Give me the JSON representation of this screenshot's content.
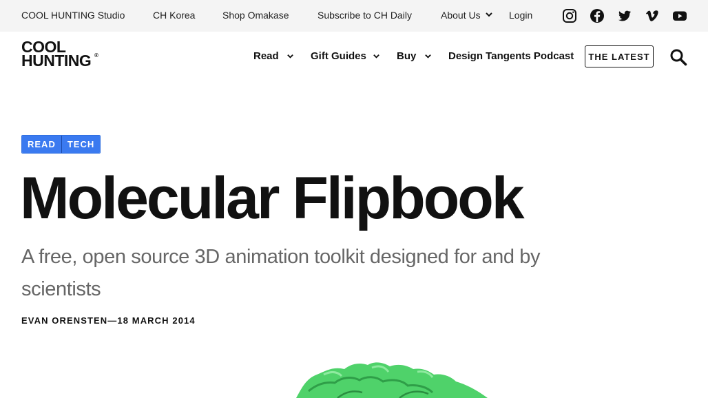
{
  "topbar": {
    "links": [
      "COOL HUNTING Studio",
      "CH Korea",
      "Shop Omakase",
      "Subscribe to CH Daily",
      "About Us",
      "Login"
    ],
    "social_icons": [
      "instagram-icon",
      "facebook-icon",
      "twitter-icon",
      "vimeo-icon",
      "youtube-icon"
    ]
  },
  "logo": {
    "line1": "COOL",
    "line2": "HUNTING",
    "mark": "®"
  },
  "nav": {
    "read": "Read",
    "gift_guides": "Gift Guides",
    "buy": "Buy",
    "podcast": "Design Tangents Podcast",
    "latest": "THE LATEST"
  },
  "article": {
    "tags": [
      "READ",
      "TECH"
    ],
    "title": "Molecular Flipbook",
    "subtitle": "A free, open source 3D animation toolkit designed for and by scientists",
    "byline": "EVAN ORENSTEN—18 MARCH 2014"
  },
  "colors": {
    "tag_blue": "#3a7af0",
    "topbar_bg": "#f4f4f4",
    "subtitle_gray": "#666666",
    "hero_green": "#4fd26a"
  }
}
